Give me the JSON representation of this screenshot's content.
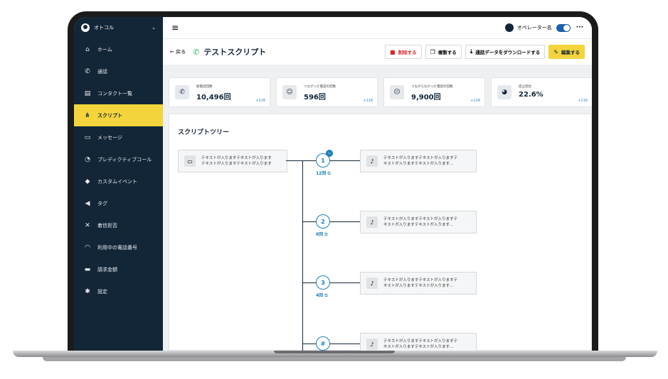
{
  "sidebar": {
    "account": "オトコル",
    "items": [
      {
        "label": "ホーム",
        "icon": "home-icon",
        "glyph": "⌂"
      },
      {
        "label": "通話",
        "icon": "phone-icon",
        "glyph": "✆"
      },
      {
        "label": "コンタクト一覧",
        "icon": "contacts-icon",
        "glyph": "▤"
      },
      {
        "label": "スクリプト",
        "icon": "script-icon",
        "glyph": "⋔"
      },
      {
        "label": "メッセージ",
        "icon": "message-icon",
        "glyph": "▭"
      },
      {
        "label": "プレディクティブコール",
        "icon": "predictive-call-icon",
        "glyph": "◔"
      },
      {
        "label": "カスタムイベント",
        "icon": "custom-event-icon",
        "glyph": "◆"
      },
      {
        "label": "タグ",
        "icon": "tag-icon",
        "glyph": "◀"
      },
      {
        "label": "着信拒否",
        "icon": "call-block-icon",
        "glyph": "✕"
      },
      {
        "label": "利用中の電話番号",
        "icon": "phone-number-icon",
        "glyph": "◠"
      },
      {
        "label": "請求金額",
        "icon": "billing-icon",
        "glyph": "▬"
      },
      {
        "label": "設定",
        "icon": "gear-icon",
        "glyph": "✱"
      }
    ],
    "active_index": 3
  },
  "topbar": {
    "operator": "オペレーター名"
  },
  "titlebar": {
    "back": "← 戻る",
    "title": "テストスクリプト",
    "delete": "削除する",
    "duplicate": "複製する",
    "download": "通話データをダウンロードする",
    "edit": "編集する"
  },
  "stats": [
    {
      "label": "総電話回数",
      "value": "10,496回",
      "delta": "+116",
      "icon": "phone-icon",
      "glyph": "✆"
    },
    {
      "label": "つながった電話の回数",
      "value": "596回",
      "delta": "+116",
      "icon": "smile-icon",
      "glyph": "☺"
    },
    {
      "label": "つながらなかった電話の回数",
      "value": "9,900回",
      "delta": "+116",
      "icon": "frown-icon",
      "glyph": "☹"
    },
    {
      "label": "成立割合",
      "value": "22.6%",
      "delta": "+116",
      "icon": "pie-chart-icon",
      "glyph": "◕"
    }
  ],
  "tree": {
    "title": "スクリプトツリー",
    "root_text_1": "テキストが入りますテキストが入ります",
    "root_text_2": "テキストが入りますテキストが入ります",
    "branches": [
      {
        "num": "1",
        "count": "12回",
        "text_1": "テキストが入りますテキストが入りますテ",
        "text_2": "キストが入りますテキストが入ります..."
      },
      {
        "num": "2",
        "count": "8回",
        "text_1": "テキストが入りますテキストが入りますテ",
        "text_2": "キストが入りますテキストが入ります..."
      },
      {
        "num": "3",
        "count": "4回",
        "text_1": "テキストが入りますテキストが入りますテ",
        "text_2": "キストが入りますテキストが入ります..."
      },
      {
        "num": "#",
        "count": "",
        "text_1": "テキストが入りますテキストが入りますテ",
        "text_2": "キストが入りますテキストが入ります..."
      }
    ]
  }
}
